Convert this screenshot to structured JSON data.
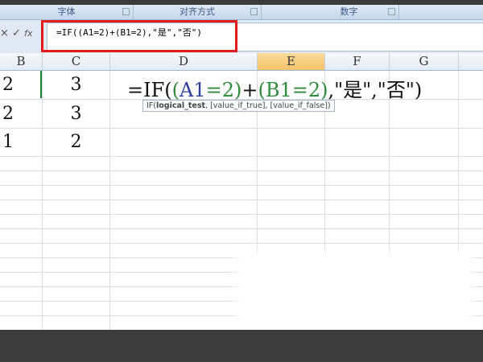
{
  "ribbon": {
    "groups": [
      "字体",
      "对齐方式",
      "数字"
    ]
  },
  "formula_bar": {
    "buttons": [
      "×",
      "✓",
      "fx"
    ],
    "value": "=IF((A1=2)+(B1=2),\"是\",\"否\")"
  },
  "columns": [
    "B",
    "C",
    "D",
    "E",
    "F",
    "G"
  ],
  "rows": [
    {
      "B": "2",
      "C": "3"
    },
    {
      "B": "2",
      "C": "3"
    },
    {
      "B": "1",
      "C": "2"
    }
  ],
  "cell_formula": {
    "p1": "=IF(",
    "p2": "(",
    "p3": "A1",
    "p4": "=2)",
    "p5": "+",
    "p6": "(B1=2)",
    "p7": ",\"是\",\"否\")"
  },
  "tooltip": {
    "fn": "IF(",
    "arg1": "logical_test",
    "rest": ", [value_if_true], [value_if_false])"
  }
}
